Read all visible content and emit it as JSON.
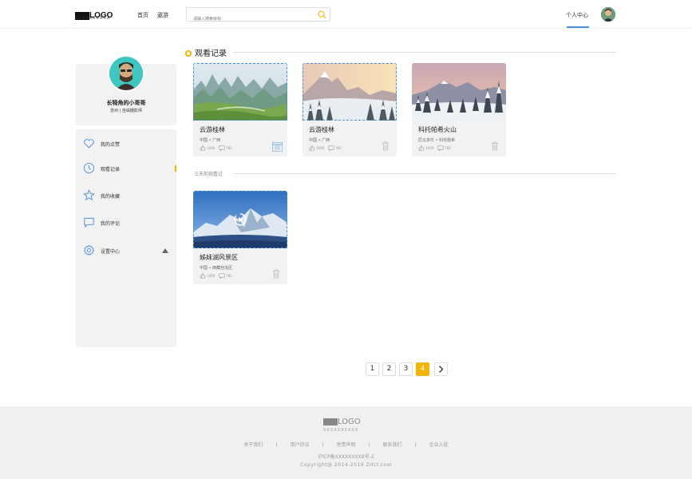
{
  "header": {
    "logo": "LOGO",
    "logo_sub": "XXXXXXXXXX",
    "nav": [
      {
        "label": "首页"
      },
      {
        "label": "遨游"
      }
    ],
    "search_placeholder": "请输入搜索目标",
    "personal_center": "个人中心"
  },
  "profile": {
    "username": "长犄角的小哥哥",
    "location": "苏州 | 自由摄影师"
  },
  "sidebar": {
    "items": [
      {
        "label": "我的点赞",
        "icon": "heart-icon"
      },
      {
        "label": "观看记录",
        "icon": "clock-icon",
        "active": true
      },
      {
        "label": "我的收藏",
        "icon": "star-icon"
      },
      {
        "label": "我的评论",
        "icon": "comment-icon"
      },
      {
        "label": "设置中心",
        "icon": "gear-icon"
      }
    ]
  },
  "main": {
    "section_title": "观看记录",
    "subsection_title": "三天前观看过",
    "cards": [
      {
        "title": "云游桂林",
        "location": "中国 • 广西",
        "likes": "1000",
        "comments": "782"
      },
      {
        "title": "云游桂林",
        "location": "中国 • 广西",
        "likes": "1000",
        "comments": "782"
      },
      {
        "title": "科托帕希火山",
        "location": "厄瓜多尔 • 科托帕希",
        "likes": "1000",
        "comments": "782"
      },
      {
        "title": "姊妹湖风景区",
        "location": "中国 • 西藏自治区",
        "likes": "1000",
        "comments": "782"
      }
    ]
  },
  "pagination": {
    "pages": [
      "1",
      "2",
      "3",
      "4"
    ],
    "current": "4"
  },
  "footer": {
    "logo": "LOGO",
    "logo_sub": "XXXXXXXXXX",
    "links": [
      "关于我们",
      "|",
      "用户协议",
      "|",
      "免责声明",
      "|",
      "联系我们",
      "|",
      "企业入驻"
    ],
    "icp": "沪ICP备XXXXXXXXX号-2",
    "copyright": "Copyright@ 2014-2019 ZHLY.com"
  },
  "colors": {
    "accent": "#f5b400",
    "link_blue": "#4a90d9",
    "panel_bg": "#f2f2f2"
  }
}
